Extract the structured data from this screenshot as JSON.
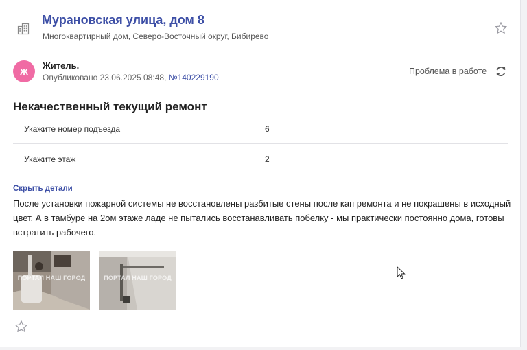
{
  "address": {
    "title": "Мурановская улица, дом 8",
    "subtitle": "Многоквартирный дом, Северо-Восточный округ, Бибирево",
    "icon": "building-icon"
  },
  "author": {
    "avatar_letter": "Ж",
    "avatar_color": "#f06ba4",
    "name": "Житель.",
    "published_prefix": "Опубликовано 23.06.2025 08:48, ",
    "ticket_number": "№140229190"
  },
  "status": {
    "label": "Проблема в работе",
    "icon": "refresh-icon"
  },
  "problem": {
    "title": "Некачественный текущий ремонт",
    "fields": [
      {
        "label": "Укажите номер подъезда",
        "value": "6"
      },
      {
        "label": "Укажите этаж",
        "value": "2"
      }
    ]
  },
  "details": {
    "toggle_label": "Скрыть детали",
    "text": "После установки пожарной системы не восстановлены разбитые стены после кап ремонта и не покрашены в исходный цвет. А в тамбуре на 2ом этаже ладе не пытались восстанавливать побелку - мы практически постоянно дома, готовы встратить рабочего."
  },
  "photos": [
    {
      "watermark": "ПОРТАЛ НАШ ГОРОД"
    },
    {
      "watermark": "ПОРТАЛ НАШ ГОРОД"
    }
  ],
  "colors": {
    "accent": "#3d4fa6",
    "avatar": "#f06ba4"
  }
}
